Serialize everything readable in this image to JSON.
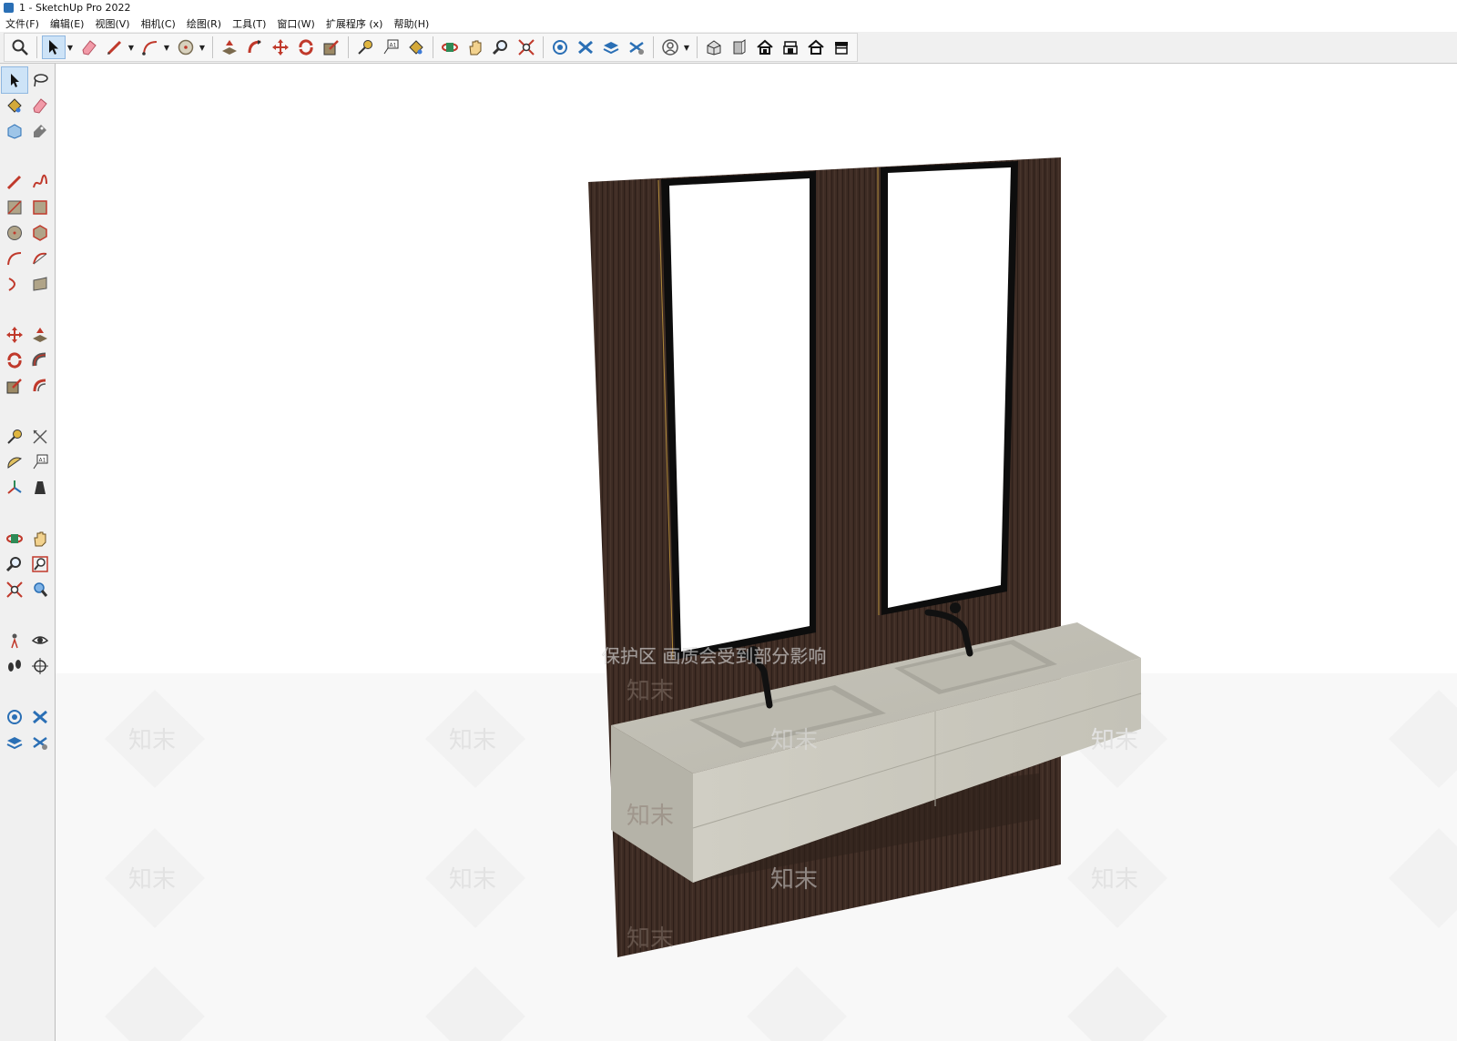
{
  "window": {
    "title": "1 - SketchUp Pro 2022"
  },
  "menu": {
    "items": [
      "文件(F)",
      "编辑(E)",
      "视图(V)",
      "相机(C)",
      "绘图(R)",
      "工具(T)",
      "窗口(W)",
      "扩展程序 (x)",
      "帮助(H)"
    ]
  },
  "toolbar": {
    "icons": [
      "search-icon",
      "select-icon",
      "eraser-icon",
      "pencil-icon",
      "arc-icon",
      "circle-icon",
      "push-pull-icon",
      "follow-me-icon",
      "move-icon",
      "rotate-icon",
      "scale-icon",
      "tape-measure-icon",
      "text-icon",
      "paint-bucket-icon",
      "orbit-icon",
      "pan-icon",
      "zoom-icon",
      "zoom-extents-icon",
      "warehouse-icon",
      "extension-icon",
      "layers-icon",
      "sandbox-icon",
      "account-icon",
      "iso-view-icon",
      "front-view-icon",
      "top-view-icon",
      "right-view-icon",
      "back-view-icon",
      "left-view-icon"
    ]
  },
  "colors": {
    "accent": "#2a6fb5",
    "wall_wood": "#3e2c24",
    "stone": "#c9c7bd",
    "faucet": "#111111",
    "mirror_frame": "#0d0d0d"
  },
  "watermark": {
    "banner": "保护区 画质会受到部分影响",
    "tile_text": "知末"
  }
}
